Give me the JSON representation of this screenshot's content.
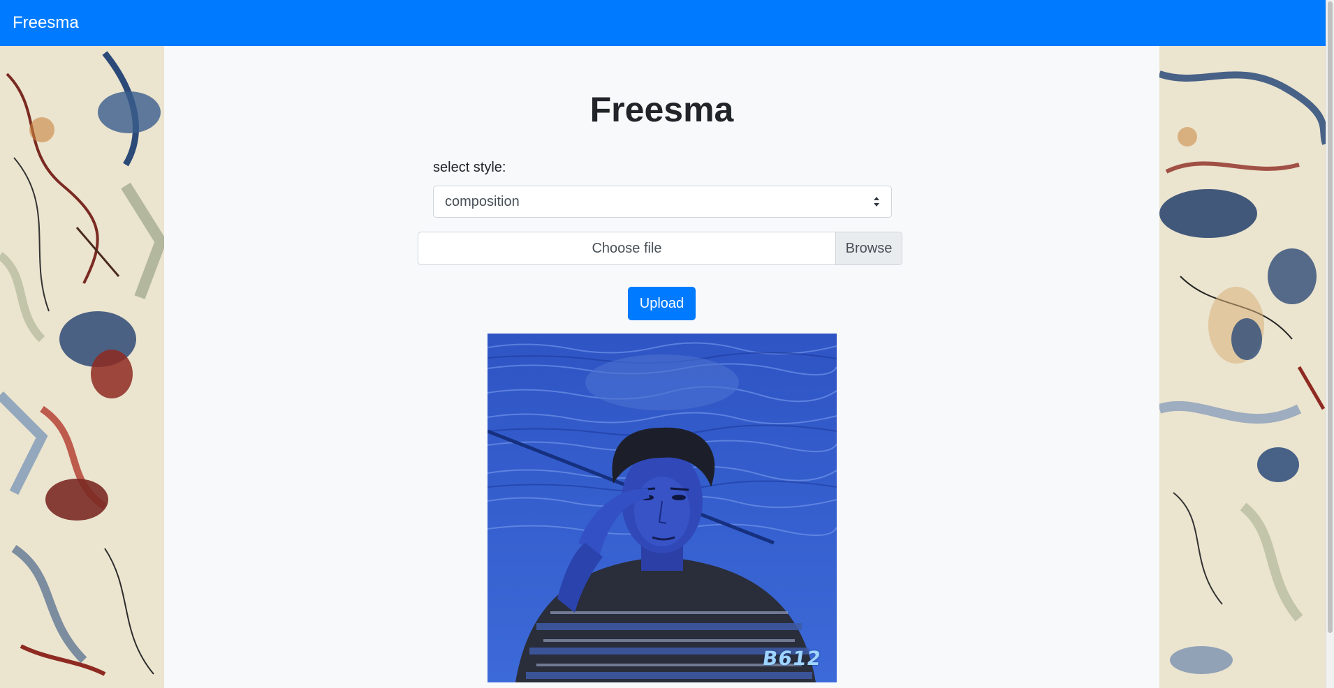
{
  "navbar": {
    "brand": "Freesma",
    "color": "#007bff"
  },
  "main": {
    "title": "Freesma",
    "style_label": "select style:",
    "style_select": {
      "selected": "composition"
    },
    "file_input": {
      "label": "Choose file",
      "button": "Browse"
    },
    "upload_button": "Upload",
    "result_image": {
      "watermark": "B612"
    }
  },
  "colors": {
    "primary": "#007bff",
    "container_bg": "#f8f9fa",
    "text": "#212529"
  }
}
